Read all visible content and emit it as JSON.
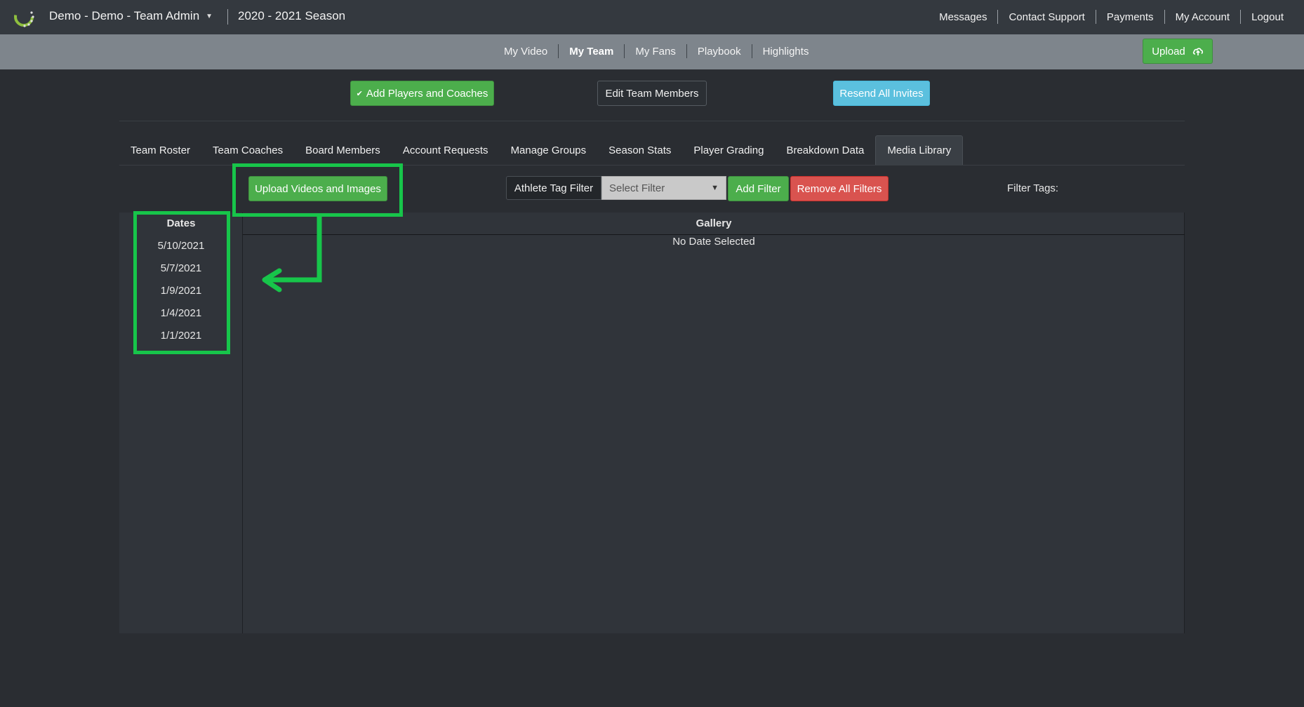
{
  "header": {
    "team_name": "Demo - Demo - Team Admin",
    "season": "2020 - 2021 Season",
    "links": [
      "Messages",
      "Contact Support",
      "Payments",
      "My Account",
      "Logout"
    ]
  },
  "subnav": {
    "items": [
      {
        "label": "My Video",
        "active": false
      },
      {
        "label": "My Team",
        "active": true
      },
      {
        "label": "My Fans",
        "active": false
      },
      {
        "label": "Playbook",
        "active": false
      },
      {
        "label": "Highlights",
        "active": false
      }
    ],
    "upload_label": "Upload"
  },
  "actions": {
    "add_players": "Add Players and Coaches",
    "edit_members": "Edit Team Members",
    "resend_invites": "Resend All Invites"
  },
  "tabs": [
    {
      "label": "Team Roster",
      "active": false
    },
    {
      "label": "Team Coaches",
      "active": false
    },
    {
      "label": "Board Members",
      "active": false
    },
    {
      "label": "Account Requests",
      "active": false
    },
    {
      "label": "Manage Groups",
      "active": false
    },
    {
      "label": "Season Stats",
      "active": false
    },
    {
      "label": "Player Grading",
      "active": false
    },
    {
      "label": "Breakdown Data",
      "active": false
    },
    {
      "label": "Media Library",
      "active": true
    }
  ],
  "media": {
    "upload_button": "Upload Videos and Images",
    "filter_label": "Athlete Tag Filter",
    "filter_select": "Select Filter",
    "add_filter": "Add Filter",
    "remove_filters": "Remove All Filters",
    "filter_tags_label": "Filter Tags:",
    "dates_header": "Dates",
    "gallery_header": "Gallery",
    "no_date": "No Date Selected",
    "dates": [
      "5/10/2021",
      "5/7/2021",
      "1/9/2021",
      "1/4/2021",
      "1/1/2021"
    ]
  },
  "colors": {
    "highlight": "#17c54a",
    "success": "#4cae4c",
    "info": "#5bc0de",
    "danger": "#d9534f"
  },
  "icons": {
    "logo": "circle-dots-logo",
    "caret": "caret-down-icon",
    "upload": "cloud-upload-icon",
    "chevron": "chevron-down-icon",
    "select": "select-arrow-icon"
  }
}
